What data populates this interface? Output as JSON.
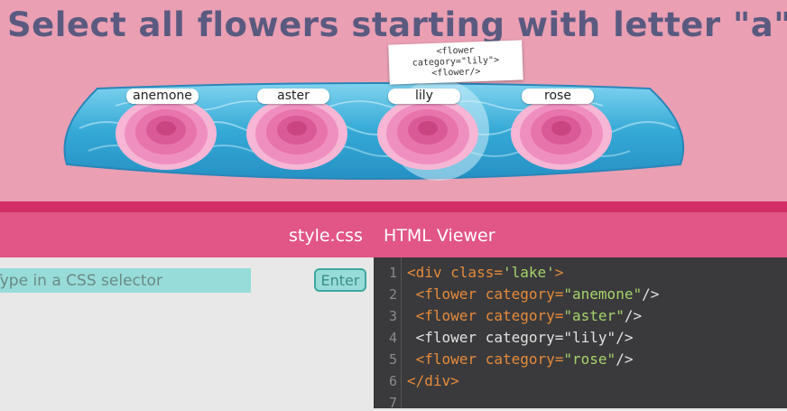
{
  "title": "Select all flowers starting with letter \"a\"",
  "flowers": [
    {
      "label": "anemone"
    },
    {
      "label": "aster"
    },
    {
      "label": "lily"
    },
    {
      "label": "rose"
    }
  ],
  "tooltip": {
    "line1": "<flower",
    "line2": "category=\"lily\">",
    "line3": "<flower/>"
  },
  "tabs": {
    "style": "style.css",
    "html": "HTML Viewer"
  },
  "selector": {
    "placeholder": "Type in a CSS selector",
    "enter_label": "Enter"
  },
  "editor": {
    "line_numbers": [
      "1",
      "2",
      "3",
      "4",
      "5",
      "6",
      "7"
    ],
    "lines": [
      {
        "open": "<div",
        "attr": " class=",
        "value": "'lake'",
        "close": ">"
      },
      {
        "open": " <flower",
        "attr": " category=",
        "value": "\"anemone\"",
        "close": "/>"
      },
      {
        "open": " <flower",
        "attr": " category=",
        "value": "\"aster\"",
        "close": "/>"
      },
      {
        "open": " <flower",
        "attr": " category=",
        "value": "\"lily\"",
        "close": "/>"
      },
      {
        "open": " <flower",
        "attr": " category=",
        "value": "\"rose\"",
        "close": "/>"
      },
      {
        "open": "</div>",
        "attr": "",
        "value": "",
        "close": ""
      }
    ]
  },
  "colors": {
    "top_bg": "#ea9fb3",
    "accent_stripe": "#d42e66",
    "tab_bar": "#e25587",
    "water": "#35a9d6",
    "flower_petal": "#ef8fc0",
    "input_bg": "#97dcd8",
    "editor_bg": "#3a3a3c"
  }
}
